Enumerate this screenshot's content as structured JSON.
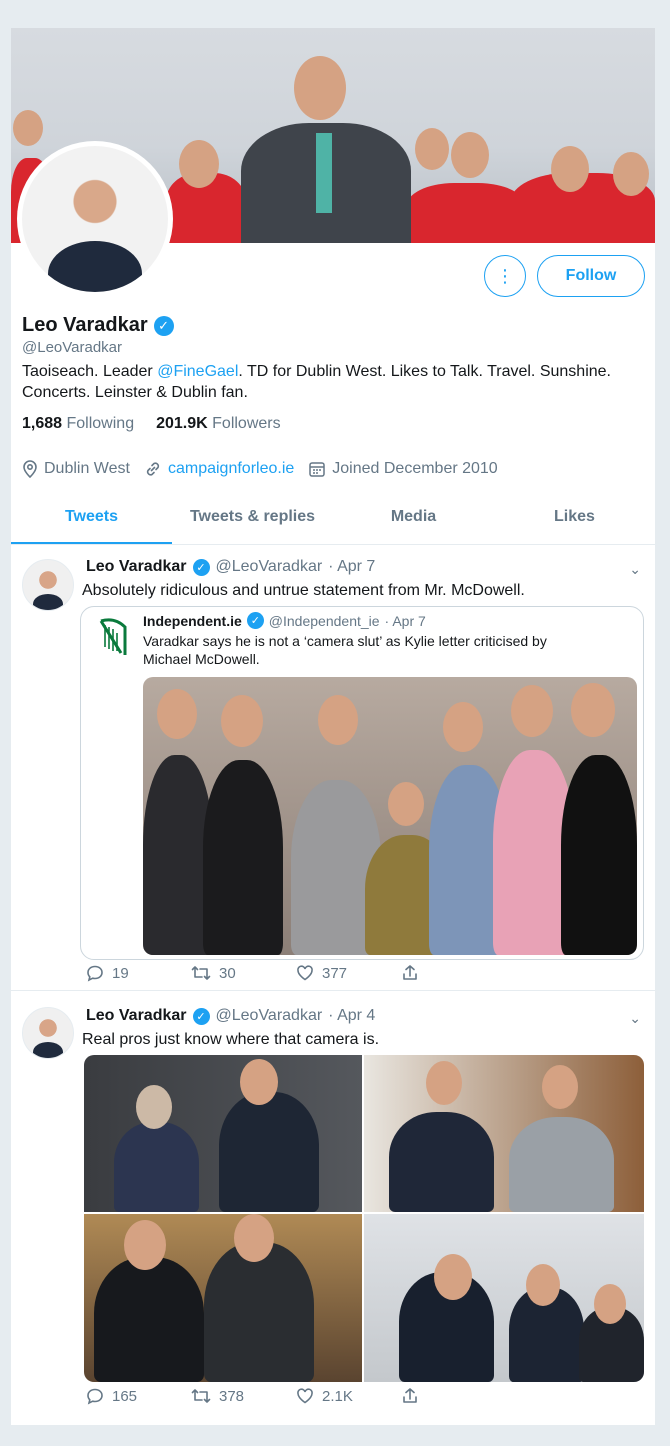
{
  "profile": {
    "name": "Leo Varadkar",
    "handle": "@LeoVaradkar",
    "bio_prefix": "Taoiseach. Leader ",
    "bio_mention": "@FineGael",
    "bio_suffix": ". TD for Dublin West. Likes to Talk. Travel. Sunshine. Concerts. Leinster & Dublin fan.",
    "following_count": "1,688",
    "following_label": "Following",
    "followers_count": "201.9K",
    "followers_label": "Followers",
    "location": "Dublin West",
    "website": "campaignforleo.ie",
    "joined": "Joined December 2010",
    "follow_label": "Follow",
    "more_icon": "more-options-icon"
  },
  "tabs": [
    "Tweets",
    "Tweets & replies",
    "Media",
    "Likes"
  ],
  "tweets": [
    {
      "name": "Leo Varadkar",
      "handle": "@LeoVaradkar",
      "date": "· Apr 7",
      "text": "Absolutely ridiculous and untrue statement from Mr. McDowell.",
      "quote": {
        "name": "Independent.ie",
        "handle": "@Independent_ie",
        "date": "· Apr 7",
        "text": "Varadkar says he is not a ‘camera slut’ as Kylie letter criticised by Michael McDowell."
      },
      "replies": "19",
      "retweets": "30",
      "likes": "377"
    },
    {
      "name": "Leo Varadkar",
      "handle": "@LeoVaradkar",
      "date": "· Apr 4",
      "text": "Real pros just know where that camera is.",
      "replies": "165",
      "retweets": "378",
      "likes": "2.1K"
    }
  ],
  "colors": {
    "accent": "#1da1f2",
    "muted": "#657786",
    "border": "#e6ecf0"
  }
}
